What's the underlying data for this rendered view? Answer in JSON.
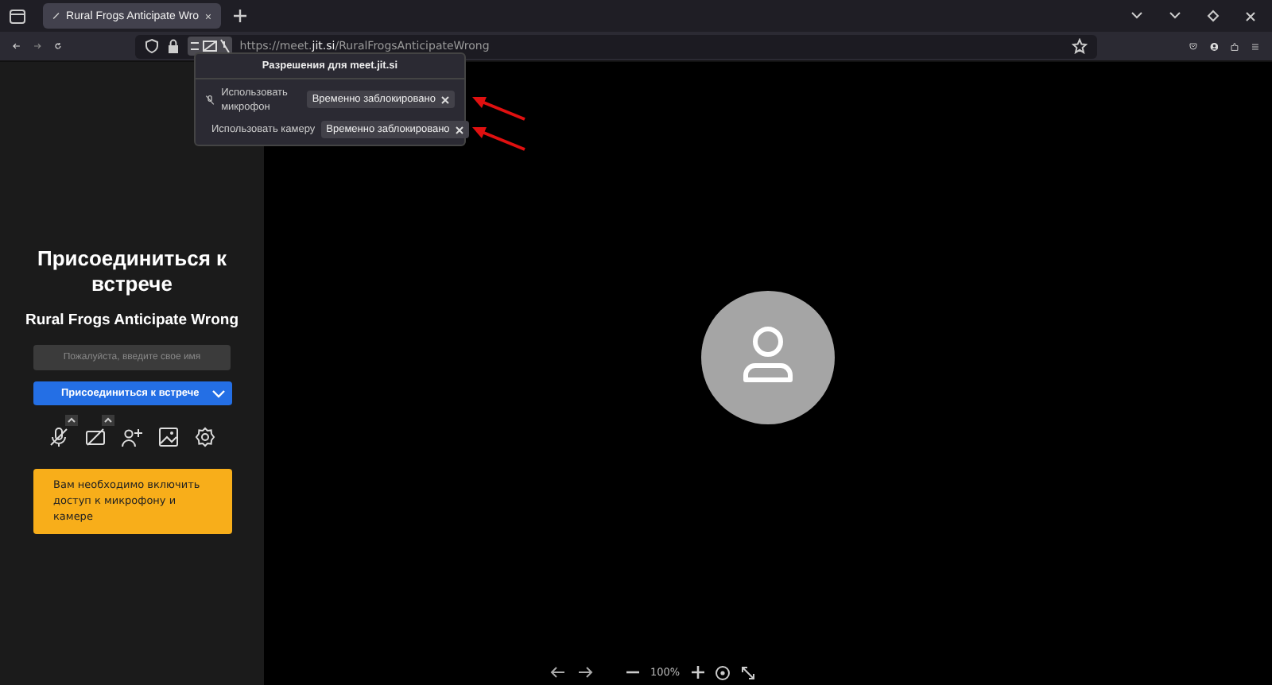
{
  "tab": {
    "title": "Rural Frogs Anticipate Wro"
  },
  "address_bar": {
    "url_prefix": "https://meet.",
    "url_domain": "jit.si",
    "url_path": "/RuralFrogsAnticipateWrong"
  },
  "permissions_popup": {
    "title": "Разрешения для meet.jit.si",
    "items": [
      {
        "kind": "microphone",
        "label": "Использовать микрофон",
        "status": "Временно заблокировано"
      },
      {
        "kind": "camera",
        "label": "Использовать камеру",
        "status": "Временно заблокировано"
      }
    ]
  },
  "prejoin": {
    "title": "Присоединиться к встрече",
    "meeting_name": "Rural Frogs Anticipate Wrong",
    "name_field": {
      "placeholder": "Пожалуйста, введите свое имя"
    },
    "join_button": "Присоединиться к встрече",
    "toolbar": [
      {
        "kind": "mic",
        "has_menu": true
      },
      {
        "kind": "camera",
        "has_menu": true
      },
      {
        "kind": "invite",
        "has_menu": false
      },
      {
        "kind": "background",
        "has_menu": false
      },
      {
        "kind": "settings",
        "has_menu": false
      }
    ],
    "warning": "Вам необходимо включить доступ к микрофону и камере"
  },
  "bottom_toolbar": {
    "zoom": "100%"
  }
}
